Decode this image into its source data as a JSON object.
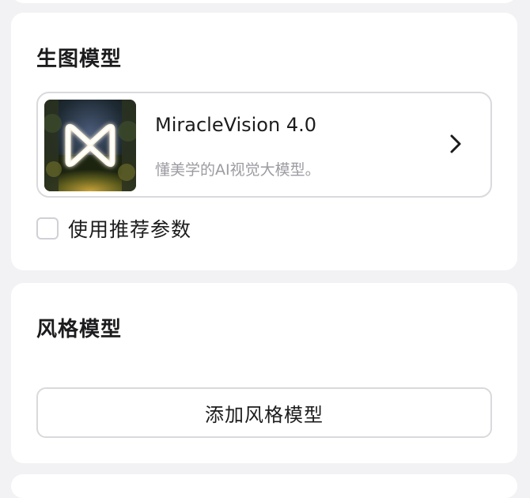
{
  "generation_model": {
    "title": "生图模型",
    "selected_model": {
      "name": "MiracleVision 4.0",
      "description": "懂美学的AI视觉大模型。",
      "thumbnail_icon": "miraclevision-logo-thumbnail"
    },
    "use_recommended_params": {
      "label": "使用推荐参数",
      "checked": false
    }
  },
  "style_model": {
    "title": "风格模型",
    "add_button_label": "添加风格模型"
  },
  "colors": {
    "page_background": "#f2f2f5",
    "card_background": "#ffffff",
    "border": "#d9d9de",
    "muted_text": "#9b9ba1"
  }
}
